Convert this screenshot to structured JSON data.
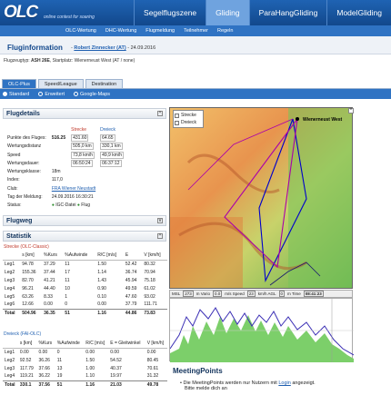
{
  "header": {
    "logo": "OLC",
    "tagline": "online contest for soaring",
    "tabs": [
      "Segelflugszene",
      "Gliding",
      "ParaHangGliding",
      "ModelGliding"
    ]
  },
  "subnav": [
    "OLC-Wertung",
    "DHC-Wertung",
    "Flugmeldung",
    "Teilnehmer",
    "Regeln"
  ],
  "title": {
    "heading": "Fluginformation",
    "pilot": "Robert Zinnecker (AT)",
    "date": "24.09.2016"
  },
  "flight_info": {
    "label_type": "Flugzeugtyp:",
    "aircraft": "ASH 26E",
    "label_start": "Startplatz",
    "startplace": "Wienerneust West (AT / none)"
  },
  "tabs": [
    "OLC-Plus",
    "Speed/League",
    "Destination"
  ],
  "radio_options": [
    "Standard",
    "Erweitert",
    "Google-Maps"
  ],
  "flugdetails": {
    "title": "Flugdetails",
    "col_strecke": "Strecke",
    "col_dreieck": "Dreieck",
    "rows": [
      {
        "label": "Punkte des Fluges:",
        "value": "516.25",
        "strecke": "431.60",
        "dreieck": "64.65"
      },
      {
        "label": "Wertungsdistanz",
        "value": "",
        "strecke": "505,0 km",
        "dreieck": "330,1 km"
      },
      {
        "label": "Speed",
        "value": "",
        "strecke": "73,8 km/h",
        "dreieck": "49,9 km/h"
      },
      {
        "label": "Wertungsdauer:",
        "value": "",
        "strecke": "06:50:24",
        "dreieck": "06:37:12"
      },
      {
        "label": "Wertungsklasse:",
        "value": "18m",
        "strecke": "",
        "dreieck": ""
      },
      {
        "label": "Index:",
        "value": "117,0",
        "strecke": "",
        "dreieck": ""
      },
      {
        "label": "Club:",
        "value": "FRA Wiener Neustadt",
        "strecke": "",
        "dreieck": ""
      },
      {
        "label": "Tag der Meldung:",
        "value": "24.09.2016 16:30:21",
        "strecke": "",
        "dreieck": ""
      },
      {
        "label": "Status:",
        "value": "IGC-Datei",
        "strecke": "",
        "dreieck": ""
      }
    ],
    "status_extra": "Flug"
  },
  "flugweg": {
    "title": "Flugweg"
  },
  "statistik": {
    "title": "Statistik",
    "strecke_label": "Strecke (OLC-Classic)",
    "headers": [
      "",
      "s [km]",
      "%Kurs",
      "%Aufwinde",
      "R/C [m/s]",
      "E",
      "V [km/h]"
    ],
    "strecke_rows": [
      [
        "Leg1",
        "94.78",
        "37.29",
        "11",
        "1.50",
        "52.42",
        "80.32"
      ],
      [
        "Leg2",
        "155.36",
        "37.44",
        "17",
        "1.14",
        "36.74",
        "70.94"
      ],
      [
        "Leg3",
        "82.70",
        "41.21",
        "11",
        "1.43",
        "45.94",
        "75.18"
      ],
      [
        "Leg4",
        "96.21",
        "44.40",
        "10",
        "0.90",
        "49.59",
        "61.02"
      ],
      [
        "Leg5",
        "63.26",
        "8.33",
        "1",
        "0.10",
        "47.60",
        "93.02"
      ],
      [
        "Leg6",
        "12.66",
        "0.00",
        "0",
        "0.00",
        "37.79",
        "111.71"
      ],
      [
        "Total",
        "504.96",
        "36.35",
        "51",
        "1.16",
        "44.86",
        "73.83"
      ]
    ],
    "dreieck_label": "Dreieck (FAI-OLC)",
    "dreieck_headers": [
      "",
      "s [km]",
      "%Kurs",
      "%Aufwinde",
      "R/C [m/s]",
      "E = Gleitwinkel",
      "V [km/h]"
    ],
    "dreieck_rows": [
      [
        "Leg1",
        "0.00",
        "0.00",
        "0",
        "0.00",
        "0.00",
        "0.00"
      ],
      [
        "Leg2",
        "92.52",
        "36.26",
        "11",
        "1.50",
        "54.52",
        "80.45"
      ],
      [
        "Leg3",
        "117.79",
        "37.66",
        "13",
        "1.00",
        "40.37",
        "70.61"
      ],
      [
        "Leg4",
        "119.21",
        "36.22",
        "19",
        "1.10",
        "19.97",
        "31.32"
      ],
      [
        "Total",
        "330.1",
        "37.56",
        "51",
        "1.16",
        "21.03",
        "49.78"
      ]
    ]
  },
  "map": {
    "legend": [
      "Strecke",
      "Dreieck"
    ],
    "place_label": "Wienerneust West"
  },
  "baro_bar": {
    "items": [
      "MSL",
      "273",
      "m Vario",
      "0.0",
      "m/s Speed",
      "23",
      "km/h AGL",
      "0",
      "m Time",
      "08:41:23"
    ]
  },
  "meeting_points": {
    "title": "MeetingPoints",
    "text_before": "Die MeetingPoints werden nur Nutzern mit",
    "link": "Login",
    "text_after": "angezeigt.",
    "line2": "Bitte melde dich an"
  },
  "colors": {
    "header_blue": "#1f63b3",
    "strecke_line": "#0000cc",
    "dreieck_line": "#aa00aa",
    "baro_fill": "#7ccf6a",
    "baro_line": "#3b2fb5"
  }
}
